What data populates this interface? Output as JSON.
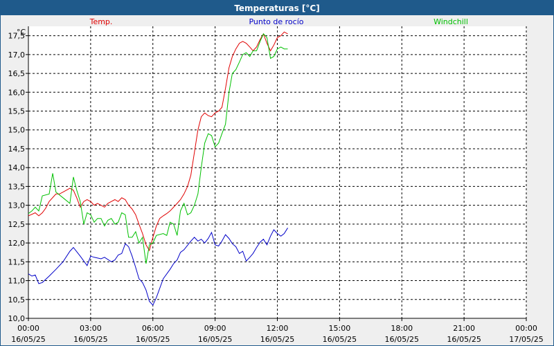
{
  "window": {
    "title": "Temperaturas [°C]"
  },
  "chart_data": {
    "type": "line",
    "title": "Temperaturas [°C]",
    "ylabel": "°C",
    "ylim": [
      10.0,
      17.75
    ],
    "yticks": [
      10.0,
      10.5,
      11.0,
      11.5,
      12.0,
      12.5,
      13.0,
      13.5,
      14.0,
      14.5,
      15.0,
      15.5,
      16.0,
      16.5,
      17.0,
      17.5
    ],
    "ytick_labels": [
      "10,0",
      "10,5",
      "11,0",
      "11,5",
      "12,0",
      "12,5",
      "13,0",
      "13,5",
      "14,0",
      "14,5",
      "15,0",
      "15,5",
      "16,0",
      "16,5",
      "17,0",
      "17,5"
    ],
    "xlim": [
      0,
      24
    ],
    "xticks": [
      0,
      3,
      6,
      9,
      12,
      15,
      18,
      21,
      24
    ],
    "xtick_labels": [
      [
        "00:00",
        "16/05/25"
      ],
      [
        "03:00",
        "16/05/25"
      ],
      [
        "06:00",
        "16/05/25"
      ],
      [
        "09:00",
        "16/05/25"
      ],
      [
        "12:00",
        "16/05/25"
      ],
      [
        "15:00",
        "16/05/25"
      ],
      [
        "18:00",
        "16/05/25"
      ],
      [
        "21:00",
        "16/05/25"
      ],
      [
        "00:00",
        "17/05/25"
      ]
    ],
    "grid": true,
    "legend_position": "top",
    "series": [
      {
        "name": "Temp.",
        "color": "#e00000",
        "x": [
          0,
          0.33,
          0.5,
          0.67,
          0.83,
          1,
          1.33,
          1.5,
          1.67,
          2,
          2.17,
          2.33,
          2.5,
          2.67,
          2.83,
          3,
          3.17,
          3.33,
          3.5,
          3.67,
          3.83,
          4,
          4.17,
          4.33,
          4.5,
          4.67,
          4.83,
          5,
          5.17,
          5.33,
          5.5,
          5.67,
          5.83,
          6,
          6.17,
          6.33,
          6.5,
          6.67,
          6.83,
          7,
          7.17,
          7.33,
          7.5,
          7.67,
          7.83,
          8,
          8.17,
          8.33,
          8.5,
          8.67,
          8.83,
          9,
          9.17,
          9.33,
          9.5,
          9.67,
          9.83,
          10,
          10.17,
          10.33,
          10.5,
          10.67,
          10.83,
          11,
          11.17,
          11.33,
          11.5,
          11.67,
          11.83,
          12,
          12.17,
          12.33,
          12.5
        ],
        "values": [
          12.72,
          12.8,
          12.72,
          12.8,
          12.92,
          13.1,
          13.3,
          13.3,
          13.35,
          13.45,
          13.4,
          13.2,
          12.95,
          13.1,
          13.15,
          13.1,
          13.0,
          13.05,
          13.0,
          12.95,
          13.05,
          13.1,
          13.15,
          13.1,
          13.2,
          13.15,
          13.0,
          12.9,
          12.75,
          12.5,
          12.25,
          11.95,
          11.8,
          12.15,
          12.45,
          12.65,
          12.72,
          12.78,
          12.85,
          12.95,
          13.05,
          13.15,
          13.3,
          13.5,
          13.8,
          14.4,
          15.0,
          15.35,
          15.45,
          15.38,
          15.35,
          15.45,
          15.5,
          15.6,
          16.1,
          16.65,
          16.95,
          17.15,
          17.3,
          17.35,
          17.3,
          17.2,
          17.1,
          17.2,
          17.4,
          17.55,
          17.3,
          17.1,
          17.25,
          17.45,
          17.5,
          17.6,
          17.55
        ]
      },
      {
        "name": "Punto de rocío",
        "color": "#0000c8",
        "x": [
          0,
          0.17,
          0.33,
          0.5,
          0.67,
          1,
          1.33,
          1.67,
          2,
          2.17,
          2.5,
          2.83,
          3,
          3.17,
          3.5,
          3.67,
          4,
          4.17,
          4.33,
          4.5,
          4.67,
          4.83,
          5,
          5.17,
          5.33,
          5.5,
          5.67,
          5.83,
          6,
          6.17,
          6.5,
          6.83,
          7,
          7.17,
          7.33,
          7.5,
          7.83,
          8,
          8.17,
          8.33,
          8.5,
          8.67,
          8.83,
          9,
          9.17,
          9.33,
          9.5,
          9.67,
          9.83,
          10,
          10.17,
          10.33,
          10.5,
          10.67,
          10.83,
          11,
          11.17,
          11.33,
          11.5,
          11.67,
          11.83,
          12,
          12.17,
          12.33,
          12.5
        ],
        "values": [
          11.18,
          11.12,
          11.15,
          10.92,
          10.95,
          11.12,
          11.3,
          11.5,
          11.78,
          11.88,
          11.65,
          11.4,
          11.65,
          11.62,
          11.58,
          11.62,
          11.5,
          11.55,
          11.68,
          11.72,
          11.98,
          11.9,
          11.65,
          11.35,
          11.05,
          10.95,
          10.75,
          10.45,
          10.35,
          10.55,
          11.05,
          11.3,
          11.45,
          11.55,
          11.75,
          11.82,
          12.05,
          12.15,
          12.05,
          12.1,
          12.0,
          12.12,
          12.28,
          11.95,
          11.92,
          12.05,
          12.22,
          12.12,
          11.98,
          11.9,
          11.72,
          11.78,
          11.52,
          11.62,
          11.72,
          11.88,
          12.02,
          12.1,
          11.95,
          12.18,
          12.35,
          12.25,
          12.18,
          12.25,
          12.4
        ]
      },
      {
        "name": "Windchill",
        "color": "#00c000",
        "x": [
          0,
          0.17,
          0.33,
          0.5,
          0.67,
          1,
          1.17,
          1.33,
          1.67,
          2,
          2.17,
          2.33,
          2.5,
          2.67,
          2.83,
          3,
          3.17,
          3.33,
          3.5,
          3.67,
          3.83,
          4,
          4.17,
          4.33,
          4.5,
          4.67,
          4.83,
          5,
          5.17,
          5.33,
          5.5,
          5.67,
          5.83,
          6,
          6.17,
          6.5,
          6.67,
          6.83,
          7,
          7.17,
          7.33,
          7.5,
          7.67,
          7.83,
          8,
          8.17,
          8.33,
          8.5,
          8.67,
          8.83,
          9,
          9.17,
          9.33,
          9.5,
          9.67,
          9.83,
          10,
          10.17,
          10.33,
          10.5,
          10.67,
          10.83,
          11,
          11.17,
          11.33,
          11.5,
          11.67,
          11.83,
          12,
          12.17,
          12.33,
          12.5
        ],
        "values": [
          12.78,
          12.85,
          12.95,
          12.85,
          13.25,
          13.3,
          13.85,
          13.35,
          13.2,
          13.05,
          13.75,
          13.4,
          13.1,
          12.5,
          12.8,
          12.75,
          12.55,
          12.65,
          12.65,
          12.45,
          12.6,
          12.65,
          12.5,
          12.55,
          12.8,
          12.75,
          12.15,
          12.15,
          12.3,
          12.0,
          12.15,
          11.45,
          11.95,
          12.0,
          12.2,
          12.25,
          12.2,
          12.55,
          12.5,
          12.2,
          12.85,
          13.05,
          12.75,
          12.8,
          13.0,
          13.3,
          14.0,
          14.65,
          14.9,
          14.85,
          14.55,
          14.65,
          14.9,
          15.15,
          16.0,
          16.5,
          16.6,
          16.8,
          17.0,
          17.05,
          16.95,
          17.1,
          17.1,
          17.35,
          17.55,
          17.45,
          16.9,
          16.95,
          17.15,
          17.2,
          17.15,
          17.15
        ]
      }
    ]
  }
}
